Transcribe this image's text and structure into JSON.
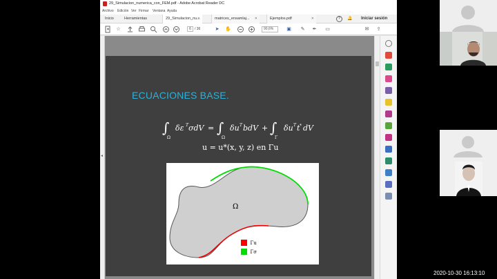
{
  "window": {
    "title": "29_Simulacion_numerica_con_FEM.pdf - Adobe Acrobat Reader DC"
  },
  "menu": [
    "Archivo",
    "Edición",
    "Ver",
    "Firmar",
    "Ventana",
    "Ayuda"
  ],
  "tabs": {
    "home": "Inicio",
    "tools": "Herramientas",
    "docs": [
      {
        "label": "29_Simulacion_nu...",
        "active": true
      },
      {
        "label": "matrices_ensamlaj...",
        "active": false
      },
      {
        "label": "Ejemplos.pdf",
        "active": false
      }
    ],
    "help": "?",
    "signin": "Iniciar sesión"
  },
  "toolbar": {
    "page_current": "6",
    "page_total": "/ 36",
    "zoom": "90,6%"
  },
  "slide": {
    "title": "ECUACIONES BASE.",
    "eq2": "u = u*(x, y, z) en Γu"
  },
  "figure": {
    "domain_label": "Ω",
    "legend": [
      {
        "label": "Γu",
        "color": "#ff0000"
      },
      {
        "label": "Γσ",
        "color": "#00dd00"
      }
    ]
  },
  "clock": "2020-10-30  16:13:10",
  "colors": {
    "slide_bg": "#3f3f3f",
    "title_accent": "#2fb0d8",
    "pdf_red": "#c8201e"
  }
}
